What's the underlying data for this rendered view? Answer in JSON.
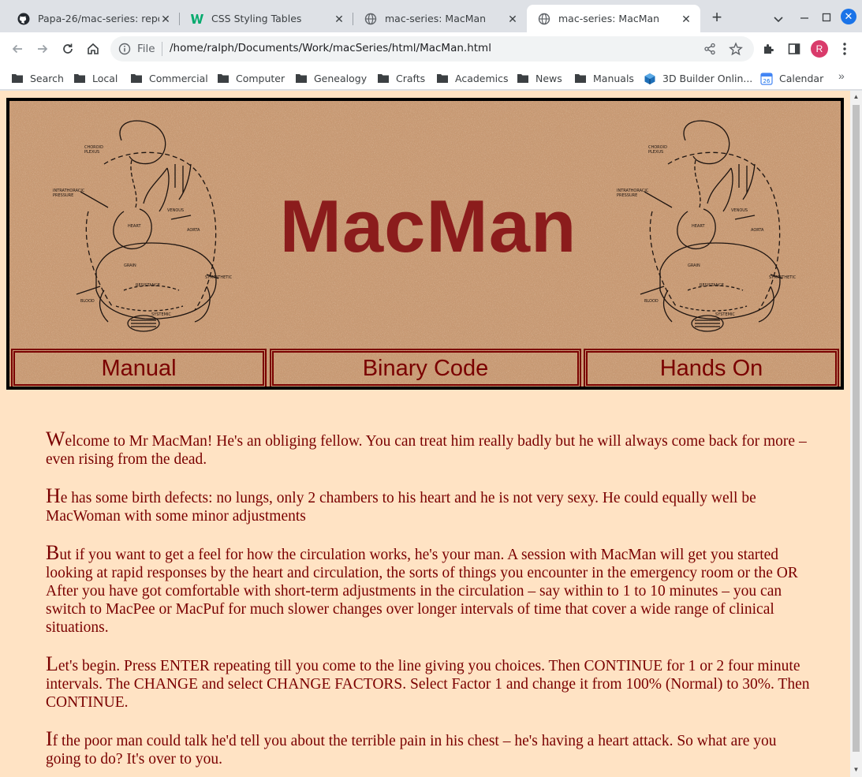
{
  "browser": {
    "tabs": [
      {
        "title": "Papa-26/mac-series: repo",
        "icon": "github-icon",
        "active": false
      },
      {
        "title": "CSS Styling Tables",
        "icon": "w3schools-icon",
        "active": false
      },
      {
        "title": "mac-series: MacMan",
        "icon": "globe-icon",
        "active": false
      },
      {
        "title": "mac-series: MacMan",
        "icon": "globe-icon",
        "active": true
      }
    ],
    "new_tab": "+",
    "omnibox": {
      "scheme_label": "File",
      "url": "/home/ralph/Documents/Work/macSeries/html/MacMan.html"
    },
    "profile_initial": "R",
    "bookmarks": [
      {
        "label": "Search",
        "icon": "folder-icon"
      },
      {
        "label": "Local",
        "icon": "folder-icon"
      },
      {
        "label": "Commercial",
        "icon": "folder-icon"
      },
      {
        "label": "Computer",
        "icon": "folder-icon"
      },
      {
        "label": "Genealogy",
        "icon": "folder-icon"
      },
      {
        "label": "Crafts",
        "icon": "folder-icon"
      },
      {
        "label": "Academics",
        "icon": "folder-icon"
      },
      {
        "label": "News",
        "icon": "folder-icon"
      },
      {
        "label": "Manuals",
        "icon": "folder-icon"
      },
      {
        "label": "3D Builder Onlin...",
        "icon": "3d-builder-icon"
      },
      {
        "label": "Calendar",
        "icon": "calendar-icon"
      }
    ],
    "bookmarks_overflow": "»"
  },
  "page": {
    "title": "MacMan",
    "nav": [
      {
        "label": "Manual"
      },
      {
        "label": "Binary Code"
      },
      {
        "label": "Hands On"
      }
    ],
    "paragraphs": [
      {
        "first": "W",
        "rest": "elcome to Mr MacMan! He's an obliging fellow. You can treat him really badly but he will always come back for more – even rising from the dead."
      },
      {
        "first": "H",
        "rest": "e has some birth defects: no lungs, only 2 chambers to his heart and he is not very sexy. He could equally well be MacWoman with some minor adjustments"
      },
      {
        "first": "B",
        "rest": "ut if you want to get a feel for how the circulation works, he's your man. A session with MacMan will get you started looking at rapid responses by the heart and circulation, the sorts of things you encounter in the emergency room or the OR After you have got comfortable with short-term adjustments in the circulation – say within to 1 to 10 minutes – you can switch to MacPee or MacPuf for much slower changes over longer intervals of time that cover a wide range of clinical situations."
      },
      {
        "first": "L",
        "rest": "et's begin. Press ENTER repeating till you come to the line giving you choices. Then CONTINUE for 1 or 2 four minute intervals. The CHANGE and select CHANGE FACTORS. Select Factor 1 and change it from 100% (Normal) to 30%. Then CONTINUE."
      },
      {
        "first": "I",
        "rest": "f the poor man could talk he'd tell you about the terrible pain in his chest – he's having a heart attack. So what are you going to do? It's over to you."
      }
    ],
    "colors": {
      "background": "#ffe3c4",
      "text": "#7a0000",
      "title": "#8b1c1c",
      "cork": "#c8956d"
    }
  }
}
